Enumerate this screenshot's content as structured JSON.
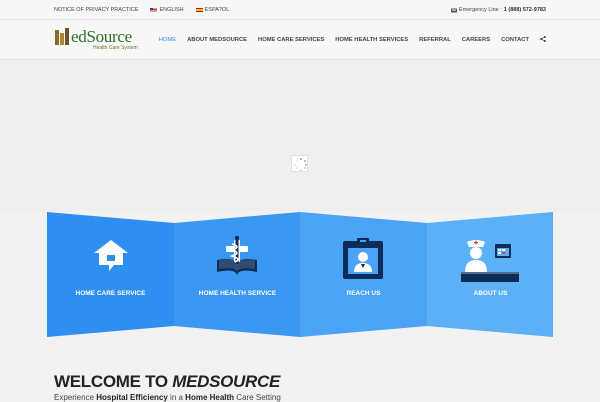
{
  "topbar": {
    "privacy": "NOTICE OF PRIVACY PRACTICE",
    "english": "ENGLISH",
    "spanish": "ESPA?OL",
    "emergency_label": "Emergency Line :",
    "emergency_number": "1 (888) 572-9783"
  },
  "logo": {
    "name": "edSource",
    "tagline": "Health Care System"
  },
  "nav": {
    "items": [
      "HOME",
      "ABOUT MEDSOURCE",
      "HOME CARE SERVICES",
      "HOME HEALTH SERVICES",
      "REFERRAL",
      "CAREERS",
      "CONTACT"
    ]
  },
  "services": [
    {
      "label": "HOME CARE SERVICE",
      "color": "#2e8ff0",
      "icon": "house-chat-icon"
    },
    {
      "label": "HOME HEALTH SERVICE",
      "color": "#3a98f2",
      "icon": "medical-book-icon"
    },
    {
      "label": "REACH US",
      "color": "#4aa3f4",
      "icon": "id-badge-icon"
    },
    {
      "label": "ABOUT US",
      "color": "#5cb0f6",
      "icon": "nurse-desk-icon"
    }
  ],
  "welcome": {
    "prefix": "WELCOME TO ",
    "brand": "MEDSOURCE"
  },
  "subline": {
    "p1": "Experience ",
    "b1": "Hospital Efficiency",
    "p2": " in a ",
    "b2": "Home Health",
    "p3": " Care Setting"
  },
  "colors": {
    "accent": "#3a8ee0",
    "logo_green": "#2f6b2f"
  }
}
